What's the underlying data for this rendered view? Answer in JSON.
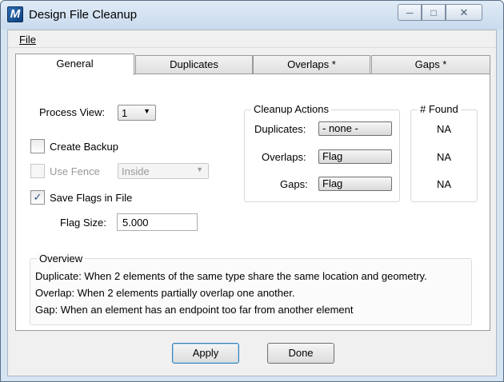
{
  "window": {
    "title": "Design File Cleanup"
  },
  "menu": {
    "file": "File"
  },
  "tabs": [
    {
      "label": "General"
    },
    {
      "label": "Duplicates"
    },
    {
      "label": "Overlaps *"
    },
    {
      "label": "Gaps *"
    }
  ],
  "general": {
    "process_view_label": "Process View:",
    "process_view_value": "1",
    "create_backup_label": "Create Backup",
    "create_backup_checked": false,
    "use_fence_label": "Use Fence",
    "use_fence_checked": false,
    "fence_mode_value": "Inside",
    "save_flags_label": "Save Flags in File",
    "save_flags_checked": true,
    "flag_size_label": "Flag Size:",
    "flag_size_value": "5.000"
  },
  "cleanup_actions": {
    "title": "Cleanup Actions",
    "rows": [
      {
        "label": "Duplicates:",
        "value": "- none -"
      },
      {
        "label": "Overlaps:",
        "value": "Flag"
      },
      {
        "label": "Gaps:",
        "value": "Flag"
      }
    ]
  },
  "found": {
    "title": "# Found",
    "values": [
      "NA",
      "NA",
      "NA"
    ]
  },
  "overview": {
    "title": "Overview",
    "lines": [
      "Duplicate: When 2 elements of the same type share the same location and geometry.",
      "Overlap: When 2 elements partially overlap one another.",
      "Gap: When an element has an endpoint too far from another element"
    ]
  },
  "buttons": {
    "apply": "Apply",
    "done": "Done"
  },
  "icons": {
    "app": "microstation-icon",
    "minimize": "minimize-icon",
    "maximize": "maximize-icon",
    "close": "close-icon",
    "dropdown": "chevron-down-icon",
    "check": "checkmark-icon"
  }
}
